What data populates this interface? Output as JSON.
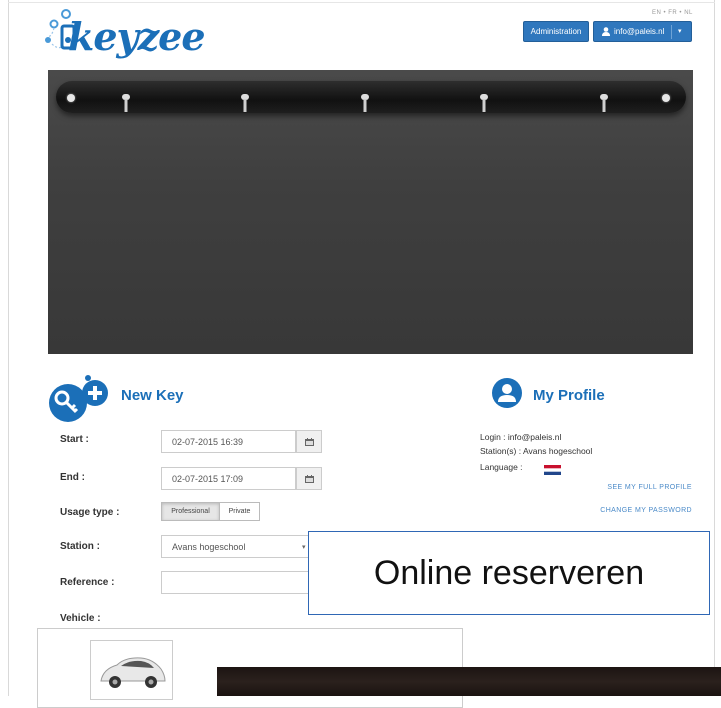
{
  "header": {
    "logo_text": "keyzee",
    "languages": "EN • FR • NL",
    "admin_button": "Administration",
    "user_button": "info@paleis.nl",
    "user_caret": "▾"
  },
  "new_key": {
    "title": "New Key",
    "start_label": "Start :",
    "start_value": "02-07-2015 16:39",
    "end_label": "End :",
    "end_value": "02-07-2015 17:09",
    "usage_label": "Usage type :",
    "usage_options": [
      "Professional",
      "Private"
    ],
    "usage_selected": "Professional",
    "station_label": "Station :",
    "station_value": "Avans hogeschool",
    "reference_label": "Reference :",
    "reference_value": "",
    "vehicle_label": "Vehicle :"
  },
  "profile": {
    "title": "My Profile",
    "login": "Login : info@paleis.nl",
    "stations": "Station(s) : Avans hogeschool",
    "language": "Language :",
    "see_profile": "SEE MY FULL PROFILE",
    "change_password": "CHANGE MY PASSWORD"
  },
  "overlay_text": "Online reserveren",
  "icons": {
    "calendar": "calendar-icon",
    "user": "user-icon",
    "key": "key-icon",
    "profile": "profile-icon",
    "flag": "netherlands-flag-icon"
  },
  "colors": {
    "brand_blue": "#1b6fb8",
    "button_blue": "#2f77bd",
    "hero_dark": "#404040",
    "link_blue": "#4a8ac8"
  }
}
